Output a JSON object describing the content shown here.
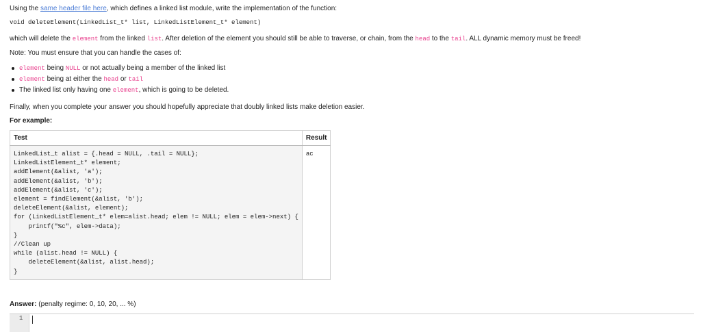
{
  "intro": {
    "prefix": "Using the ",
    "link": "same header file here",
    "suffix": ", which defines a linked list module, write the implementation of the function:"
  },
  "signature": "void deleteElement(LinkedList_t* list, LinkedListElement_t* element)",
  "description": {
    "t1": "which will delete the ",
    "c1": "element",
    "t2": " from the linked ",
    "c2": "list",
    "t3": ". After deletion of the element you should still be able to traverse, or chain, from the ",
    "c3": "head",
    "t4": " to the ",
    "c4": "tail",
    "t5": ". ALL dynamic memory must be freed!"
  },
  "note": "Note: You must ensure that you can handle the cases of:",
  "bullets": {
    "b1": {
      "c1": "element",
      "t1": " being ",
      "c2": "NULL",
      "t2": " or not actually being a member of the linked list"
    },
    "b2": {
      "c1": "element",
      "t1": " being at either the ",
      "c2": "head",
      "t2": " or ",
      "c3": "tail"
    },
    "b3": {
      "t1": "The linked list only having one ",
      "c1": "element",
      "t2": ", which is going to be deleted."
    }
  },
  "finally": "Finally, when you complete your answer you should hopefully appreciate that doubly linked lists make deletion easier.",
  "example_heading": "For example:",
  "table": {
    "header_test": "Test",
    "header_result": "Result",
    "test_code": "LinkedList_t alist = {.head = NULL, .tail = NULL};\nLinkedListElement_t* element;\naddElement(&alist, 'a');\naddElement(&alist, 'b');\naddElement(&alist, 'c');\nelement = findElement(&alist, 'b');\ndeleteElement(&alist, element);\nfor (LinkedListElement_t* elem=alist.head; elem != NULL; elem = elem->next) {\n    printf(\"%c\", elem->data);\n}\n//Clean up\nwhile (alist.head != NULL) {\n    deleteElement(&alist, alist.head);\n}",
    "result": "ac"
  },
  "answer": {
    "label": "Answer:",
    "penalty": "(penalty regime: 0, 10, 20, ... %)",
    "line_number": "1"
  }
}
